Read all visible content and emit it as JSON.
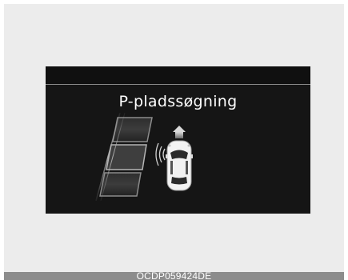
{
  "screen": {
    "title": "P-pladssøgning"
  },
  "illustration": {
    "vehicle_icon": "car-top-view-icon",
    "sensor_icon": "sensor-waves-icon",
    "direction_icon": "arrow-up-icon",
    "slots_icon": "parking-slots-icon"
  },
  "footer": {
    "code": "OCDP059424DE"
  },
  "colors": {
    "display_background": "#151515",
    "frame_background": "#ececec",
    "footer_background": "#8c8c8c",
    "text": "#ffffff"
  }
}
